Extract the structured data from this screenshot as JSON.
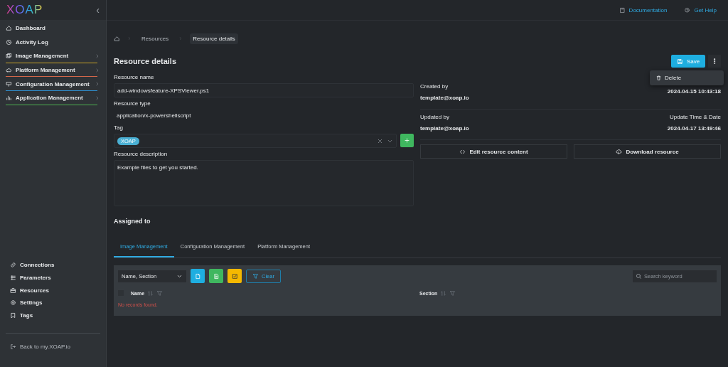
{
  "sidebar": {
    "logo": "XOAP",
    "collapse": "‹",
    "nav": [
      {
        "label": "Dashboard",
        "expandable": false
      },
      {
        "label": "Activity Log",
        "expandable": false
      },
      {
        "label": "Image Management",
        "expandable": true,
        "color": "#c9a227"
      },
      {
        "label": "Platform Management",
        "expandable": true,
        "color": "#d2664a"
      },
      {
        "label": "Configuration Management",
        "expandable": true,
        "color": "#2f8fd0"
      },
      {
        "label": "Application Management",
        "expandable": true,
        "color": "#4caf50"
      }
    ],
    "bottom": [
      {
        "label": "Connections"
      },
      {
        "label": "Parameters"
      },
      {
        "label": "Resources"
      },
      {
        "label": "Settings"
      },
      {
        "label": "Tags"
      }
    ],
    "back": "Back to my.XOAP.io"
  },
  "topbar": {
    "links": [
      {
        "label": "Documentation"
      },
      {
        "label": "Get Help"
      }
    ]
  },
  "breadcrumb": [
    {
      "label": "Resources",
      "current": false
    },
    {
      "label": "Resource details",
      "current": true
    }
  ],
  "title": "Resource details",
  "actions": {
    "save": "Save",
    "menu": [
      {
        "label": "Delete"
      }
    ]
  },
  "form": {
    "name_label": "Resource name",
    "name_value": "add-windowsfeature-XPSViewer.ps1",
    "type_label": "Resource type",
    "type_value": "application/x-powershellscript",
    "tag_label": "Tag",
    "tags": [
      "XOAP"
    ],
    "description_label": "Resource description",
    "description_value": "Example files to get you started."
  },
  "meta": [
    {
      "label": "Created by",
      "value": "template@xoap.io",
      "right_value": "2024-04-15 10:43:18"
    },
    {
      "label": "Updated by",
      "value": "template@xoap.io",
      "right_label": "Update Time & Date",
      "right_value": "2024-04-17 13:49:46"
    }
  ],
  "resource_buttons": [
    {
      "label": "Edit resource content"
    },
    {
      "label": "Download resource"
    }
  ],
  "assigned": {
    "title": "Assigned to",
    "tabs": [
      {
        "label": "Image Management",
        "selected": true
      },
      {
        "label": "Configuration Management",
        "selected": false
      },
      {
        "label": "Platform Management",
        "selected": false
      }
    ],
    "filter": "Name, Section",
    "clear": "Clear",
    "search_placeholder": "Search keyword",
    "select_all": {
      "checked": false
    },
    "columns": [
      "Name",
      "Section"
    ],
    "empty": "No records found."
  }
}
